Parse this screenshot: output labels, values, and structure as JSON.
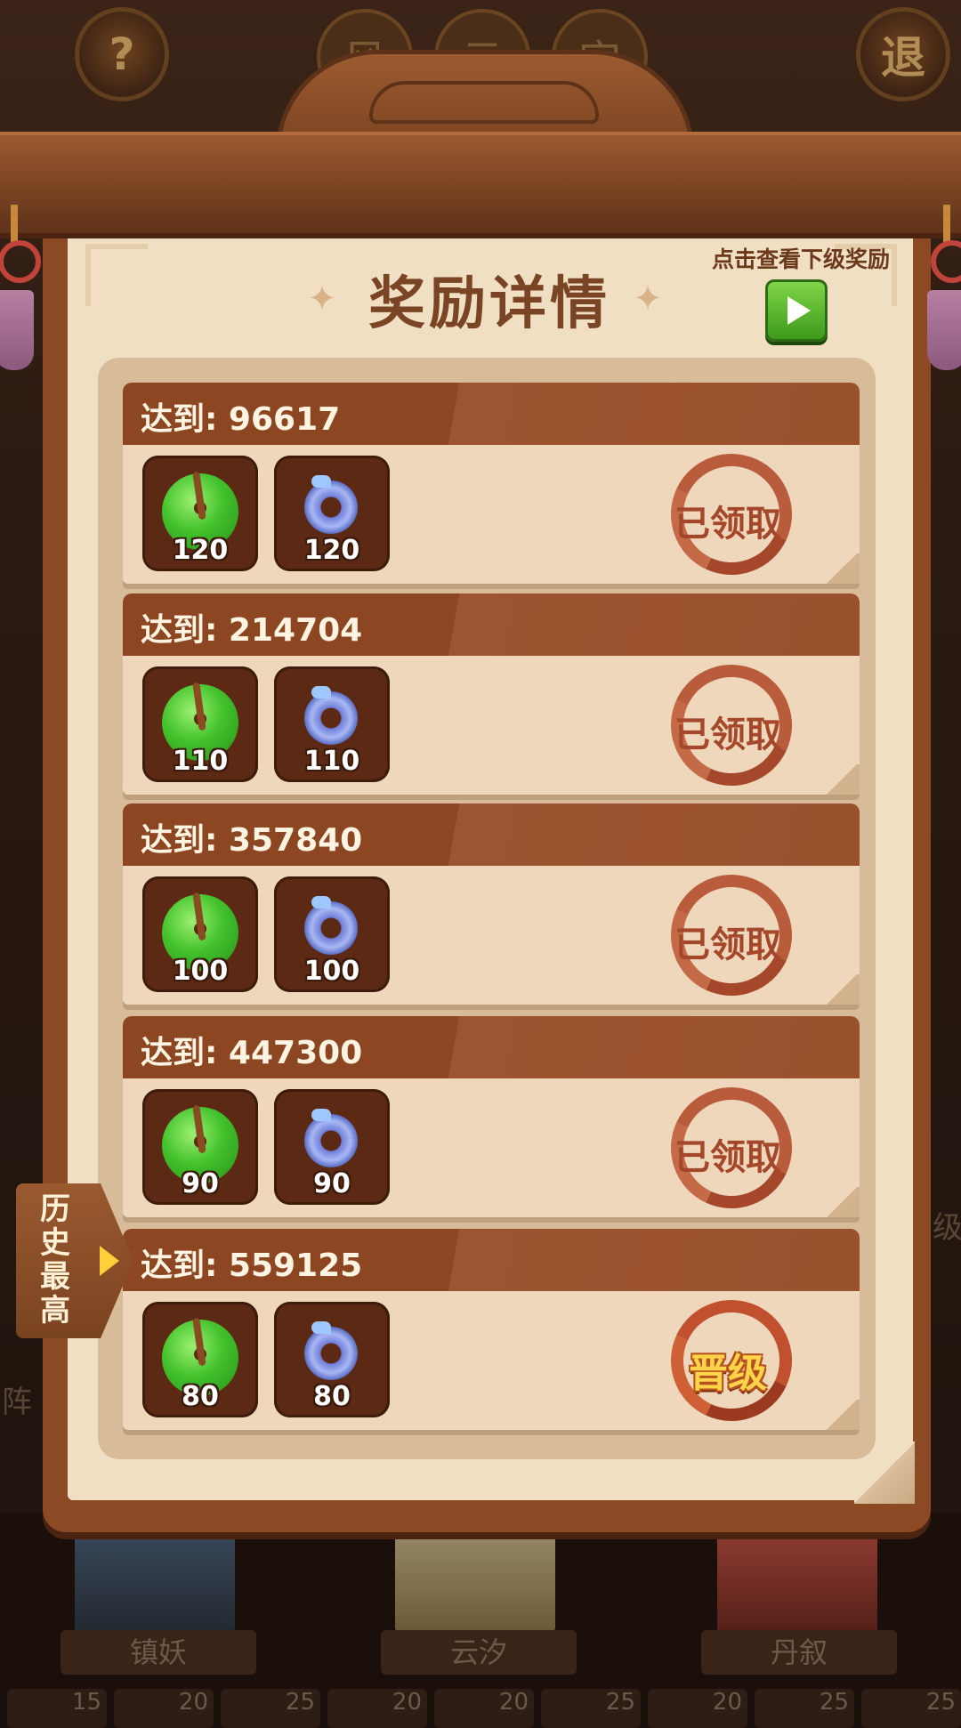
{
  "background": {
    "top_buttons": {
      "help": "?",
      "exit": "退"
    },
    "top_tabs": [
      "风",
      "云",
      "宫"
    ],
    "characters": [
      {
        "name": "镇妖"
      },
      {
        "name": "云汐"
      },
      {
        "name": "丹叙"
      }
    ],
    "levels": [
      "15",
      "20",
      "25",
      "20",
      "20",
      "25",
      "20",
      "25",
      "25"
    ],
    "side_fragments": {
      "left": "阵",
      "right": "级"
    }
  },
  "panel": {
    "title": "奖励详情",
    "next_hint": "点击查看下级奖励",
    "rows": [
      {
        "label": "达到: 96617",
        "items": [
          {
            "icon": "green-jade-pendant",
            "qty": "120"
          },
          {
            "icon": "blue-jade-ring",
            "qty": "120"
          }
        ],
        "status": "已领取",
        "state": "claimed"
      },
      {
        "label": "达到: 214704",
        "items": [
          {
            "icon": "green-jade-pendant",
            "qty": "110"
          },
          {
            "icon": "blue-jade-ring",
            "qty": "110"
          }
        ],
        "status": "已领取",
        "state": "claimed"
      },
      {
        "label": "达到: 357840",
        "items": [
          {
            "icon": "green-jade-pendant",
            "qty": "100"
          },
          {
            "icon": "blue-jade-ring",
            "qty": "100"
          }
        ],
        "status": "已领取",
        "state": "claimed"
      },
      {
        "label": "达到: 447300",
        "items": [
          {
            "icon": "green-jade-pendant",
            "qty": "90"
          },
          {
            "icon": "blue-jade-ring",
            "qty": "90"
          }
        ],
        "status": "已领取",
        "state": "claimed"
      },
      {
        "label": "达到: 559125",
        "items": [
          {
            "icon": "green-jade-pendant",
            "qty": "80"
          },
          {
            "icon": "blue-jade-ring",
            "qty": "80"
          }
        ],
        "status": "晋级",
        "state": "current"
      }
    ]
  },
  "side_tab": {
    "label": "历史最高"
  },
  "colors": {
    "wood": "#8b4a24",
    "paper": "#f1dfc4",
    "row_header": "#8d4622",
    "stamp": "#a4472a",
    "promote_text": "#ffd34a",
    "next_button": "#5cb632"
  }
}
